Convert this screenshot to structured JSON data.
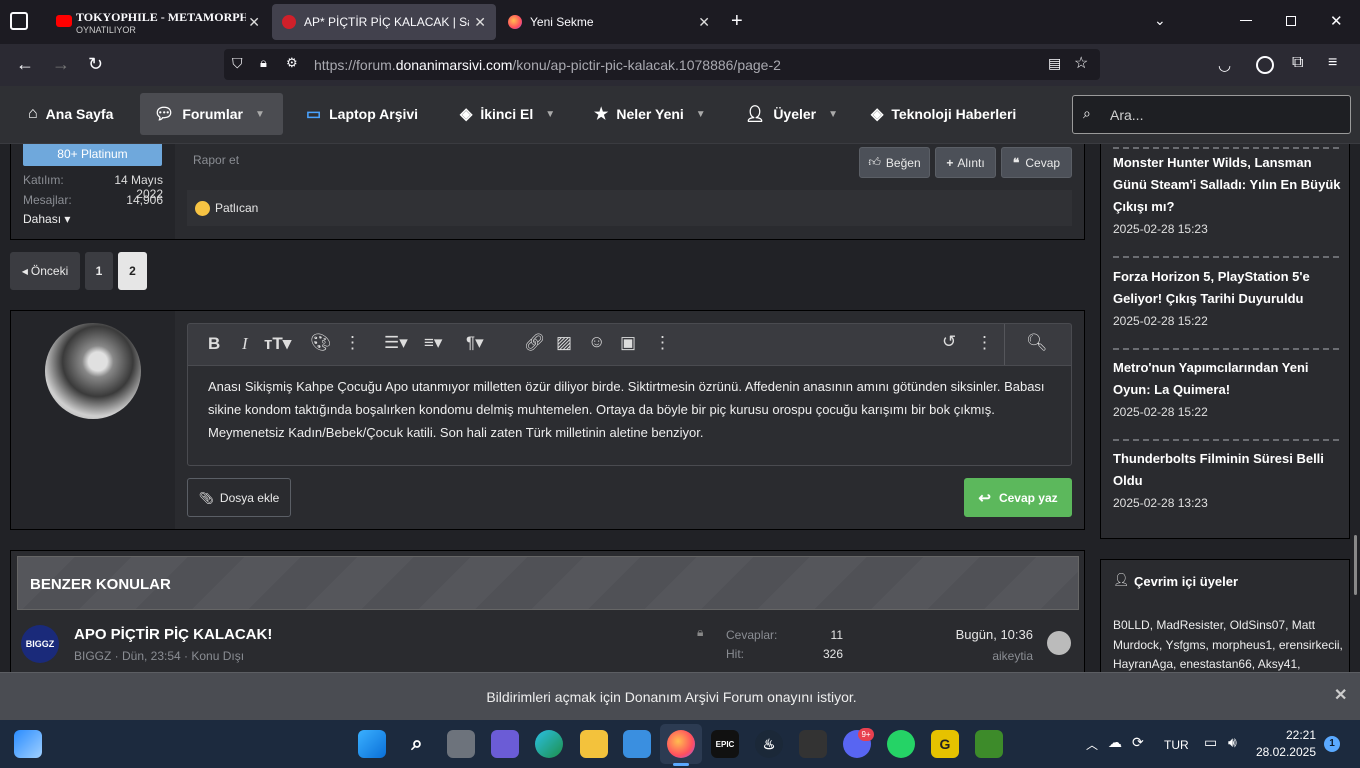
{
  "tabs": [
    {
      "title": "TOKYOPHILE - METAMORPH",
      "subtitle": "OYNATILIYOR"
    },
    {
      "title": "AP* PİÇTİR PİÇ KALACAK | Sayfa"
    },
    {
      "title": "Yeni Sekme"
    }
  ],
  "url": {
    "prefix": "https://forum.",
    "domain": "donanimarsivi.com",
    "path": "/konu/ap-pictir-pic-kalacak.1078886/page-2"
  },
  "nav": {
    "items": [
      "Ana Sayfa",
      "Forumlar",
      "Laptop Arşivi",
      "İkinci El",
      "Neler Yeni",
      "Üyeler",
      "Teknoloji Haberleri"
    ],
    "search_placeholder": "Ara..."
  },
  "post": {
    "badge": "80+ Platinum",
    "joined_label": "Katılım:",
    "joined_value": "14 Mayıs 2022",
    "messages_label": "Mesajlar:",
    "messages_value": "14,906",
    "more": "Dahası",
    "report": "Rapor et",
    "like": "Beğen",
    "quote": "Alıntı",
    "reply": "Cevap",
    "reaction": "Patlıcan"
  },
  "pagination": {
    "prev": "Önceki",
    "pages": [
      "1",
      "2"
    ],
    "current": "2"
  },
  "editor": {
    "text": "Anası Sikişmiş Kahpe Çocuğu Apo utanmıyor milletten özür diliyor birde. Siktirtmesin özrünü. Affedenin anasının amını götünden siksinler. Babası sikine kondom taktığında boşalırken kondomu delmiş muhtemelen. Ortaya da böyle bir piç kurusu orospu çocuğu karışımı bir bok çıkmış. Meymenetsiz Kadın/Bebek/Çocuk katili. Son hali zaten Türk milletinin aletine benziyor.",
    "attach": "Dosya ekle",
    "submit": "Cevap yaz"
  },
  "similar": {
    "heading": "BENZER KONULAR",
    "thread_title": "APO PİÇTİR PİÇ KALACAK!",
    "thread_meta": "BIGGZ · Dün, 23:54 · Konu Dışı",
    "avatar_text": "BIGGZ",
    "replies_label": "Cevaplar:",
    "replies_value": "11",
    "views_label": "Hit:",
    "views_value": "326",
    "last_time": "Bugün, 10:36",
    "last_user": "aikeytia"
  },
  "sidebar": {
    "news": [
      {
        "title": "Monster Hunter Wilds, Lansman Günü Steam'i Salladı: Yılın En Büyük Çıkışı mı?",
        "date": "2025-02-28 15:23"
      },
      {
        "title": "Forza Horizon 5, PlayStation 5'e Geliyor! Çıkış Tarihi Duyuruldu",
        "date": "2025-02-28 15:22"
      },
      {
        "title": "Metro'nun Yapımcılarından Yeni Oyun: La Quimera!",
        "date": "2025-02-28 15:22"
      },
      {
        "title": "Thunderbolts Filminin Süresi Belli Oldu",
        "date": "2025-02-28 13:23"
      }
    ],
    "online_title": "Çevrim içi üyeler",
    "online_list": "B0LLD, MadResister, OldSins07, Matt Murdock, Ysfgms, morpheus1, erensirkecii, HayranAga, enestastan66, Aksy41,"
  },
  "notification": {
    "text": "Bildirimleri açmak için Donanım Arşivi Forum onayını istiyor."
  },
  "taskbar": {
    "lang": "TUR",
    "time": "22:21",
    "date": "28.02.2025",
    "badge": "1",
    "discord_badge": "9+",
    "epic": "EPIC"
  }
}
